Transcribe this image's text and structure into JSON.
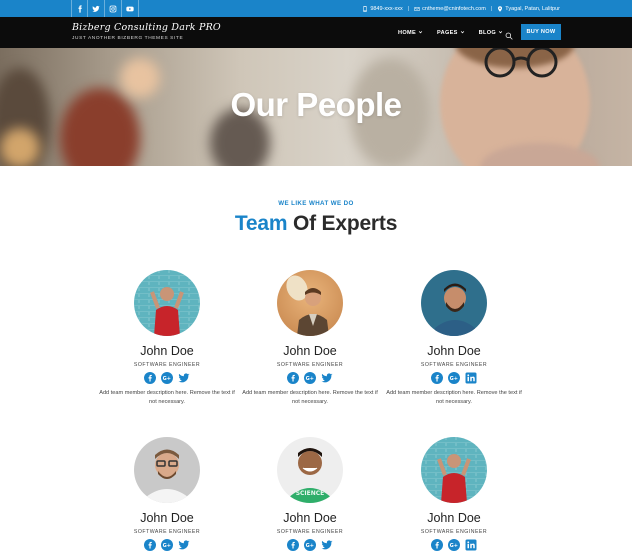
{
  "topbar": {
    "socials": [
      "facebook-icon",
      "twitter-icon",
      "instagram-icon",
      "youtube-icon"
    ],
    "phone": "9849-xxx-xxx",
    "email": "cntheme@cninfotech.com",
    "location": "Tyagal, Patan, Lalitpur",
    "separator": "|"
  },
  "header": {
    "brand_title": "Bizberg Consulting Dark PRO",
    "brand_tagline": "JUST ANOTHER BIZBERG THEMES SITE",
    "nav": [
      "HOME",
      "PAGES",
      "BLOG"
    ],
    "buy_label": "BUY NOW"
  },
  "hero": {
    "title": "Our People"
  },
  "section": {
    "eyebrow": "WE LIKE WHAT WE DO",
    "title_blue": "Team",
    "title_rest": "Of Experts"
  },
  "team": [
    {
      "name": "John Doe",
      "role": "SOFTWARE ENGINEER",
      "desc": "Add team member description here. Remove the text if not necessary.",
      "socials": [
        "facebook-icon",
        "google-plus-icon",
        "twitter-icon"
      ]
    },
    {
      "name": "John Doe",
      "role": "SOFTWARE ENGINEER",
      "desc": "Add team member description here. Remove the text if not necessary.",
      "socials": [
        "facebook-icon",
        "google-plus-icon",
        "twitter-icon"
      ]
    },
    {
      "name": "John Doe",
      "role": "SOFTWARE ENGINEER",
      "desc": "Add team member description here. Remove the text if not necessary.",
      "socials": [
        "facebook-icon",
        "google-plus-icon",
        "linkedin-icon"
      ]
    },
    {
      "name": "John Doe",
      "role": "SOFTWARE ENGINEER",
      "socials": [
        "facebook-icon",
        "google-plus-icon",
        "twitter-icon"
      ]
    },
    {
      "name": "John Doe",
      "role": "SOFTWARE ENGINEER",
      "socials": [
        "facebook-icon",
        "google-plus-icon",
        "twitter-icon"
      ]
    },
    {
      "name": "John Doe",
      "role": "SOFTWARE ENGINEER",
      "socials": [
        "facebook-icon",
        "google-plus-icon",
        "linkedin-icon"
      ]
    }
  ],
  "colors": {
    "accent": "#1a84c9",
    "header_bg": "#0c0c0c",
    "heading": "#2b2b2b"
  }
}
